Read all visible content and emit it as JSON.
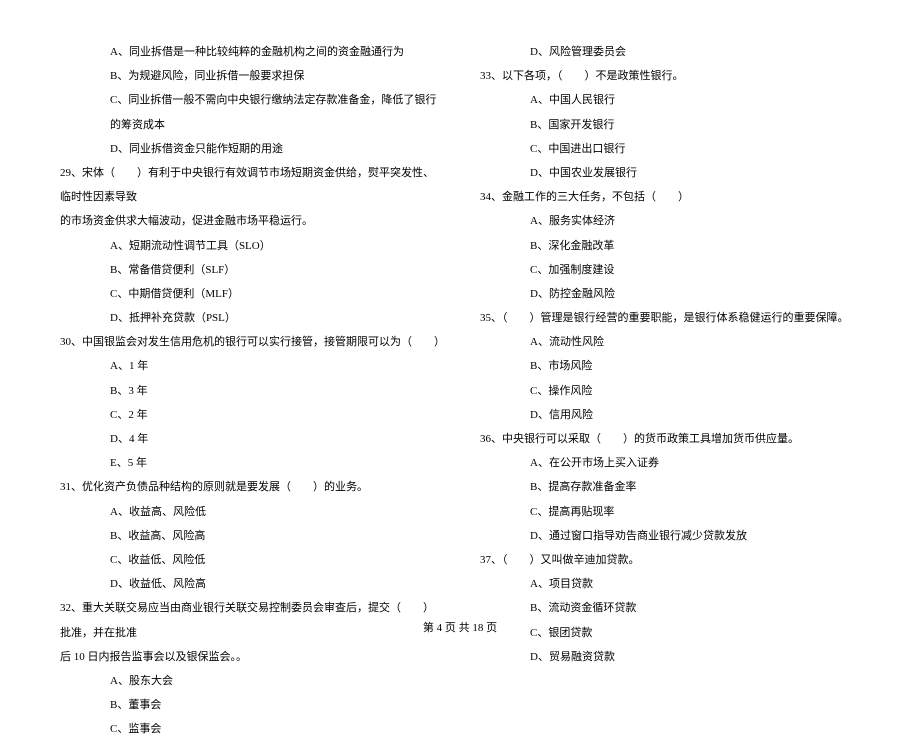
{
  "left": {
    "opt_a1": "A、同业拆借是一种比较纯粹的金融机构之间的资金融通行为",
    "opt_b1": "B、为规避风险，同业拆借一般要求担保",
    "opt_c1": "C、同业拆借一般不需向中央银行缴纳法定存款准备金，降低了银行的筹资成本",
    "opt_d1": "D、同业拆借资金只能作短期的用途",
    "q29_1": "29、宋体（　　）有利于中央银行有效调节市场短期资金供给，熨平突发性、临时性因素导致",
    "q29_2": "的市场资金供求大幅波动，促进金融市场平稳运行。",
    "q29_a": "A、短期流动性调节工具（SLO）",
    "q29_b": "B、常备借贷便利（SLF）",
    "q29_c": "C、中期借贷便利（MLF）",
    "q29_d": "D、抵押补充贷款（PSL）",
    "q30": "30、中国银监会对发生信用危机的银行可以实行接管，接管期限可以为（　　）",
    "q30_a": "A、1 年",
    "q30_b": "B、3 年",
    "q30_c": "C、2 年",
    "q30_d": "D、4 年",
    "q30_e": "E、5 年",
    "q31": "31、优化资产负债品种结构的原则就是要发展（　　）的业务。",
    "q31_a": "A、收益高、风险低",
    "q31_b": "B、收益高、风险高",
    "q31_c": "C、收益低、风险低",
    "q31_d": "D、收益低、风险高",
    "q32_1": "32、重大关联交易应当由商业银行关联交易控制委员会审查后，提交（　　）批准，并在批准",
    "q32_2": "后 10 日内报告监事会以及银保监会。。",
    "q32_a": "A、股东大会",
    "q32_b": "B、董事会",
    "q32_c": "C、监事会"
  },
  "right": {
    "q32_d": "D、风险管理委员会",
    "q33": "33、以下各项，（　　）不是政策性银行。",
    "q33_a": "A、中国人民银行",
    "q33_b": "B、国家开发银行",
    "q33_c": "C、中国进出口银行",
    "q33_d": "D、中国农业发展银行",
    "q34": "34、金融工作的三大任务，不包括（　　）",
    "q34_a": "A、服务实体经济",
    "q34_b": "B、深化金融改革",
    "q34_c": "C、加强制度建设",
    "q34_d": "D、防控金融风险",
    "q35": "35、（　　）管理是银行经营的重要职能，是银行体系稳健运行的重要保障。",
    "q35_a": "A、流动性风险",
    "q35_b": "B、市场风险",
    "q35_c": "C、操作风险",
    "q35_d": "D、信用风险",
    "q36": "36、中央银行可以采取（　　）的货币政策工具增加货币供应量。",
    "q36_a": "A、在公开市场上买入证券",
    "q36_b": "B、提高存款准备金率",
    "q36_c": "C、提高再贴现率",
    "q36_d": "D、通过窗口指导劝告商业银行减少贷款发放",
    "q37": "37、（　　）又叫做辛迪加贷款。",
    "q37_a": "A、项目贷款",
    "q37_b": "B、流动资金循环贷款",
    "q37_c": "C、银团贷款",
    "q37_d": "D、贸易融资贷款"
  },
  "footer": "第 4 页 共 18 页"
}
